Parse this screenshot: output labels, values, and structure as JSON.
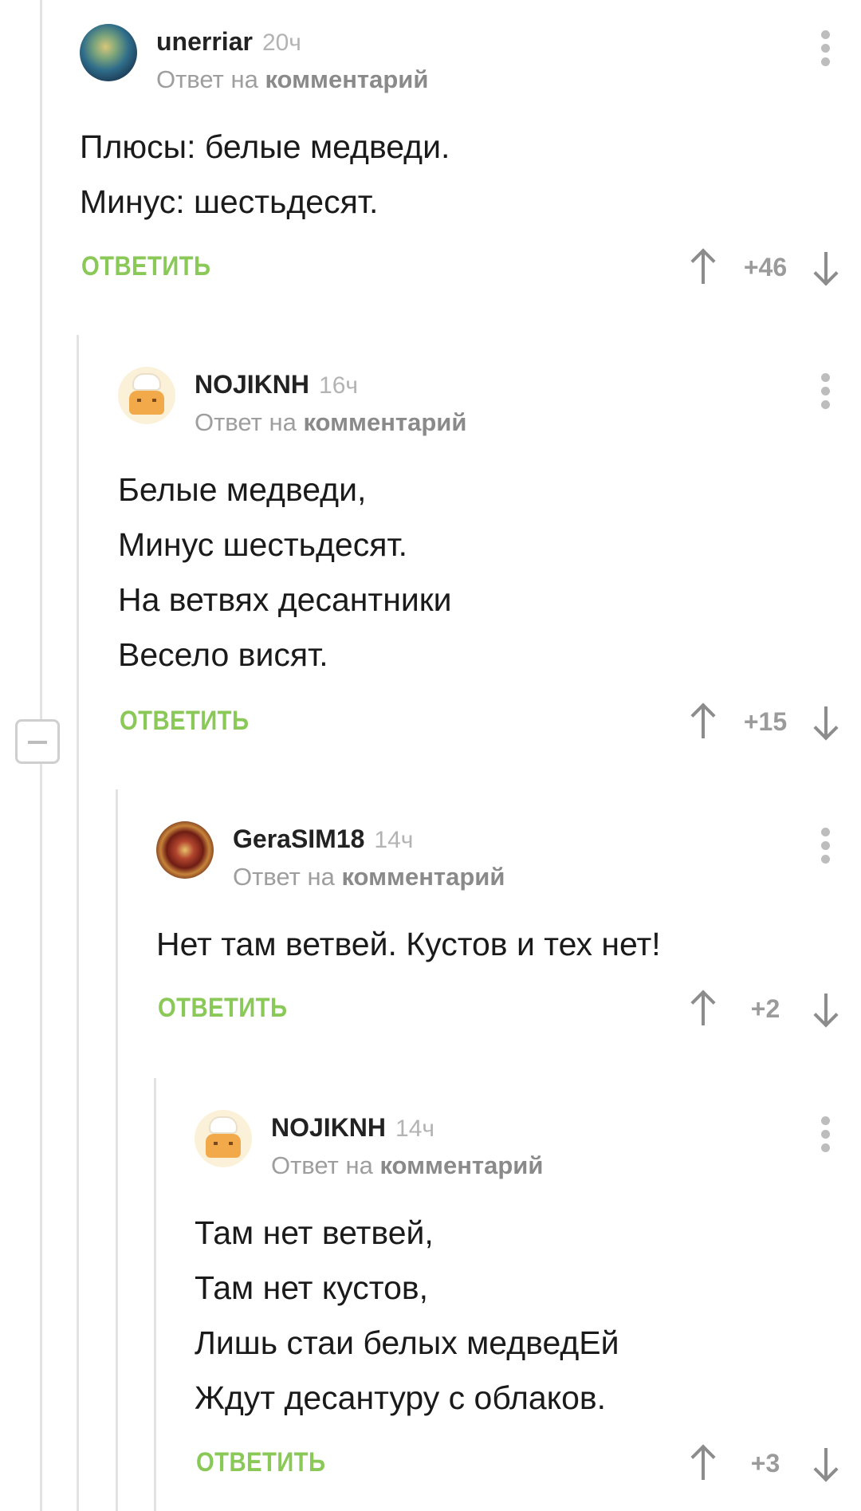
{
  "comments": [
    {
      "username": "unerriar",
      "time": "20ч",
      "reply_prefix": "Ответ на",
      "reply_target": "комментарий",
      "lines": [
        "Плюсы: белые медведи.",
        "Минус: шестьдесят."
      ],
      "reply_label": "ОТВЕТИТЬ",
      "rating": "+46",
      "avatar": "planet-avatar"
    },
    {
      "username": "NOJIKNH",
      "time": "16ч",
      "reply_prefix": "Ответ на",
      "reply_target": "комментарий",
      "lines": [
        "Белые медведи,",
        "Минус шестьдесят.",
        "На ветвях десантники",
        "Весело висят."
      ],
      "reply_label": "ОТВЕТИТЬ",
      "rating": "+15",
      "avatar": "chef-avatar"
    },
    {
      "username": "GeraSIM18",
      "time": "14ч",
      "reply_prefix": "Ответ на",
      "reply_target": "комментарий",
      "lines": [
        "Нет там ветвей. Кустов и тех нет!"
      ],
      "reply_label": "ОТВЕТИТЬ",
      "rating": "+2",
      "avatar": "mandala-avatar"
    },
    {
      "username": "NOJIKNH",
      "time": "14ч",
      "reply_prefix": "Ответ на",
      "reply_target": "комментарий",
      "lines": [
        "Там нет ветвей,",
        "Там нет кустов,",
        "Лишь стаи белых медведЕй",
        "Ждут десантуру с облаков."
      ],
      "reply_label": "ОТВЕТИТЬ",
      "rating": "+3",
      "avatar": "chef-avatar"
    }
  ],
  "colors": {
    "accent": "#8ac858",
    "meta": "#9e9e9e",
    "thread_line": "#e3e3e3"
  }
}
